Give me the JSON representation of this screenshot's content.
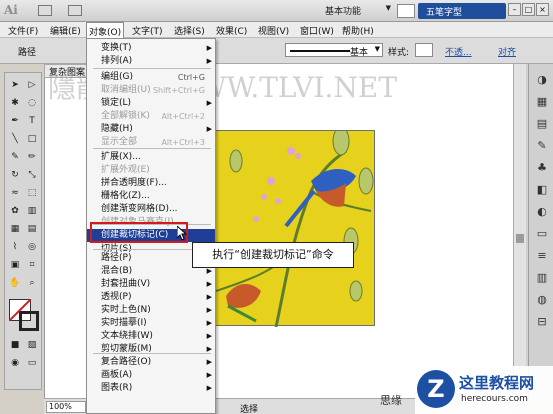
{
  "titlebar": {
    "logo": "Ai",
    "workspace": "基本功能",
    "ime": "五笔字型"
  },
  "menubar": {
    "items": [
      "文件(F)",
      "编辑(E)",
      "对象(O)",
      "文字(T)",
      "选择(S)",
      "效果(C)",
      "视图(V)",
      "窗口(W)",
      "帮助(H)"
    ]
  },
  "controlbar": {
    "label": "路径",
    "stroke_style": "基本",
    "style_label": "样式:",
    "opacity_link": "不透...",
    "align_link": "对齐"
  },
  "document": {
    "tab": "复杂图案",
    "watermark": "隱龍翁變 WWW.TLVI.NET"
  },
  "status": {
    "zoom": "100%",
    "select": "选择"
  },
  "object_menu": {
    "items": [
      {
        "label": "变换(T)",
        "shortcut": "",
        "submenu": true,
        "disabled": false
      },
      {
        "label": "排列(A)",
        "shortcut": "",
        "submenu": true,
        "disabled": false
      },
      {
        "label": "编组(G)",
        "shortcut": "Ctrl+G",
        "submenu": false,
        "disabled": false
      },
      {
        "label": "取消编组(U)",
        "shortcut": "Shift+Ctrl+G",
        "submenu": false,
        "disabled": true
      },
      {
        "label": "锁定(L)",
        "shortcut": "",
        "submenu": true,
        "disabled": false
      },
      {
        "label": "全部解锁(K)",
        "shortcut": "Alt+Ctrl+2",
        "submenu": false,
        "disabled": true
      },
      {
        "label": "隐藏(H)",
        "shortcut": "",
        "submenu": true,
        "disabled": false
      },
      {
        "label": "显示全部",
        "shortcut": "Alt+Ctrl+3",
        "submenu": false,
        "disabled": true
      },
      {
        "label": "扩展(X)...",
        "shortcut": "",
        "submenu": false,
        "disabled": false
      },
      {
        "label": "扩展外观(E)",
        "shortcut": "",
        "submenu": false,
        "disabled": true
      },
      {
        "label": "拼合透明度(F)...",
        "shortcut": "",
        "submenu": false,
        "disabled": false
      },
      {
        "label": "栅格化(Z)...",
        "shortcut": "",
        "submenu": false,
        "disabled": false
      },
      {
        "label": "创建渐变网格(D)...",
        "shortcut": "",
        "submenu": false,
        "disabled": false
      },
      {
        "label": "创建对象马赛克(J)...",
        "shortcut": "",
        "submenu": false,
        "disabled": true
      },
      {
        "label": "创建裁切标记(C)",
        "shortcut": "",
        "submenu": false,
        "disabled": false,
        "highlighted": true
      },
      {
        "label": "切片(S)",
        "shortcut": "",
        "submenu": true,
        "disabled": false
      },
      {
        "label": "路径(P)",
        "shortcut": "",
        "submenu": true,
        "disabled": false
      },
      {
        "label": "混合(B)",
        "shortcut": "",
        "submenu": true,
        "disabled": false
      },
      {
        "label": "封套扭曲(V)",
        "shortcut": "",
        "submenu": true,
        "disabled": false
      },
      {
        "label": "透视(P)",
        "shortcut": "",
        "submenu": true,
        "disabled": false
      },
      {
        "label": "实时上色(N)",
        "shortcut": "",
        "submenu": true,
        "disabled": false
      },
      {
        "label": "实时描摹(I)",
        "shortcut": "",
        "submenu": true,
        "disabled": false
      },
      {
        "label": "文本绕排(W)",
        "shortcut": "",
        "submenu": true,
        "disabled": false
      },
      {
        "label": "剪切蒙版(M)",
        "shortcut": "",
        "submenu": true,
        "disabled": false
      },
      {
        "label": "复合路径(O)",
        "shortcut": "",
        "submenu": true,
        "disabled": false
      },
      {
        "label": "画板(A)",
        "shortcut": "",
        "submenu": true,
        "disabled": false
      },
      {
        "label": "图表(R)",
        "shortcut": "",
        "submenu": true,
        "disabled": false
      }
    ]
  },
  "callout": {
    "text": "执行“创建裁切标记”命令"
  },
  "footer_partial": "思缘",
  "site": {
    "name": "这里教程网",
    "url": "herecours.com",
    "logo_letter": "Z"
  },
  "colors": {
    "artboard": "#e6d21c",
    "highlight": "#1f3f96",
    "frame": "#d31b1b",
    "brand": "#1d4fa3"
  }
}
